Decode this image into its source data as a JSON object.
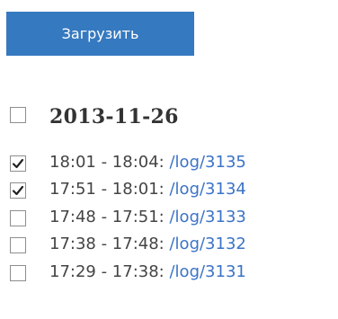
{
  "upload_button": {
    "label": "Загрузить",
    "color": "#3579c0"
  },
  "date_group": {
    "date": "2013-11-26",
    "checked": false
  },
  "logs": [
    {
      "time": "18:01 - 18:04:",
      "link": "/log/3135",
      "checked": true
    },
    {
      "time": "17:51 - 18:01:",
      "link": "/log/3134",
      "checked": true
    },
    {
      "time": "17:48 - 17:51:",
      "link": "/log/3133",
      "checked": false
    },
    {
      "time": "17:38 - 17:48:",
      "link": "/log/3132",
      "checked": false
    },
    {
      "time": "17:29 - 17:38:",
      "link": "/log/3131",
      "checked": false
    }
  ],
  "colors": {
    "link": "#3b73c7",
    "text": "#444444"
  }
}
